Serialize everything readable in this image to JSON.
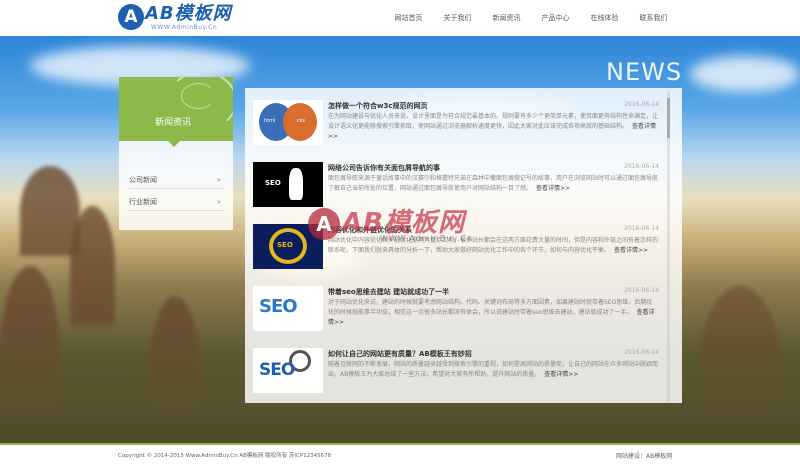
{
  "logo": {
    "mark": "A",
    "title": "AB模板网",
    "subtitle": "WWW.AdminBuy.Cn"
  },
  "nav": [
    "网站首页",
    "关于我们",
    "新闻资讯",
    "产品中心",
    "在线体验",
    "联系我们"
  ],
  "hero": {
    "heading": "NEWS"
  },
  "sidebar": {
    "title": "新闻资讯",
    "items": [
      {
        "label": "公司新闻",
        "chevron": "»"
      },
      {
        "label": "行业新闻",
        "chevron": "»"
      }
    ]
  },
  "articles": [
    {
      "title": "怎样做一个符合w3c规范的网页",
      "date": "2016-06-14",
      "thumb": "w3c",
      "thumb_a": "html",
      "thumb_b": "css",
      "summary": "在为网站建设与优化人员来说，设计里面是为符合规范最基本的。规则要有多少个更简单元素，使页面更有结构性来满足，让设计语义化更能够搜索引擎抓取，使网站通过浏览器解析速度更快，因此大家对此应该完成各项高效的基础结构。",
      "more": "查看详情>>"
    },
    {
      "title": "网络公司告诉你有关面包屑导航的事",
      "date": "2016-06-14",
      "thumb": "SEO",
      "summary": "面包屑导航来源于童话故事中的汉赛尔和格蕾特兄弟在森林中撒面包屑做记号的故事，用户在浏览网站时可以通过面包屑导航了解自己当前所处的位置，网站通过面包屑导航使用户对网站结构一目了然。",
      "more": "查看详情>>"
    },
    {
      "title": "内容优化和外链优化的关系",
      "date": "2016-06-14",
      "thumb": "SEO",
      "summary": "网站优化中内容优化和外链优化是两大重点工作，很多站长都会在这两方面花费大量的时间，但是内容和外链之间有着怎样的联系呢，下面我们就来具体的分析一下，帮助大家做好网站优化工作中的各个环节，如何与内容优化平衡。",
      "more": "查看详情>>"
    },
    {
      "title": "带着seo思维去建站 建站就成功了一半",
      "date": "2016-06-14",
      "thumb": "SEO",
      "summary": "对于网站优化来说，建站的时候就要考虑网站结构、代码、关键词布局等多方面因素，如果建站时就带着SEO思维，后期优化的时候就能事半功倍，相信这一点很多站长都深有体会，所以说建站时带着seo思维去建站，建站就成功了一半。",
      "more": "查看详情>>"
    },
    {
      "title": "如何让自己的网站更有质量？AB模板王有妙招",
      "date": "2016-06-14",
      "thumb": "SEO",
      "summary": "随着互联网的不断发展，网站的质量越来越受到搜索引擎的重视，如何提高网站的质量呢，让自己的网站在众多网站中脱颖而出，AB模板王为大家总结了一些方法，希望对大家有所帮助，提升网站的质量。",
      "more": "查看详情>>"
    }
  ],
  "watermark": {
    "mark": "A",
    "title": "AB模板网",
    "subtitle": "WWW.AdminBuy.Cn"
  },
  "footer": {
    "copyright": "Copyright © 2014-2015 Www.AdminBuy.Cn AB模板网 版权所有   苏ICP12345678",
    "right": "网站建设：AB模板网"
  },
  "colors": {
    "brand_blue": "#1d5fb0",
    "accent_green": "#8db94a",
    "watermark_red": "#c82d46"
  }
}
